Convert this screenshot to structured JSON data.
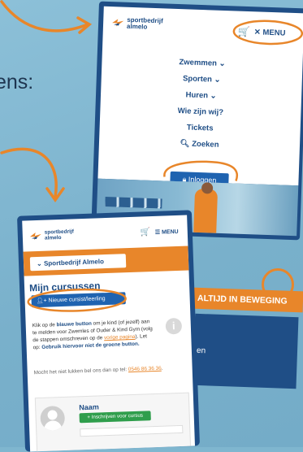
{
  "background": {
    "partial_text": "ens:"
  },
  "phone1": {
    "logo_line1": "sportbedrijf",
    "logo_line2": "almelo",
    "menu_label": "MENU",
    "nav": [
      "Zwemmen",
      "Sporten",
      "Huren",
      "Wie zijn wij?",
      "Tickets",
      "Zoeken"
    ],
    "login_label": "Inloggen",
    "slogan": "ALTIJD IN BEWEGING",
    "panel_fragment": "en"
  },
  "phone2": {
    "logo_line1": "sportbedrijf",
    "logo_line2": "almelo",
    "menu_label": "MENU",
    "dropdown_label": "Sportbedrijf Almelo",
    "title": "Mijn cursussen",
    "new_student_label": "Nieuwe cursist/leerling",
    "info_part1": "Klik op de ",
    "info_bold1": "blauwe button",
    "info_part2": " om je kind (of jezelf) aan te melden voor Zwemles of Ouder & Kind Gym (volg de stappen omschreven op de ",
    "info_link": "vorige pagina",
    "info_part3": "). Let op: ",
    "info_bold2": "Gebruik hiervoor niet de groene button.",
    "contact_text": "Mocht het niet lukken bel ons dan op tel: ",
    "contact_phone": "0546 86 36 36",
    "contact_end": ".",
    "card_name": "Naam",
    "enroll_label": "Inschrijven voor cursus"
  },
  "colors": {
    "brand_blue": "#1f4e86",
    "accent_orange": "#e8862a",
    "green": "#2f9e4c"
  }
}
